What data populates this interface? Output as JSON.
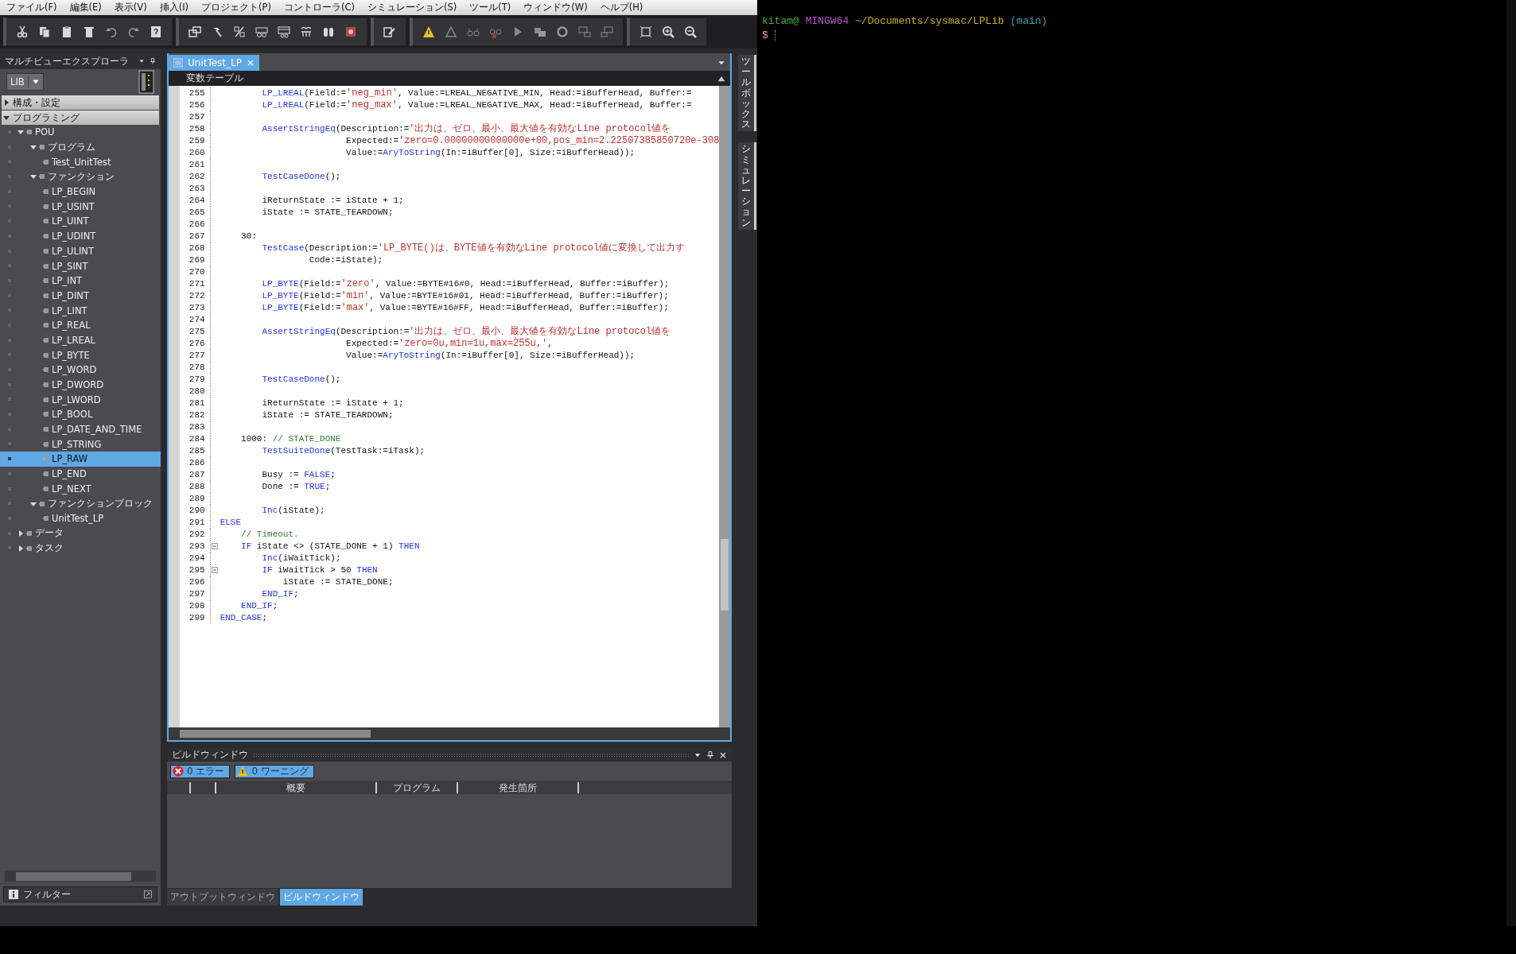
{
  "menu": [
    "ファイル(F)",
    "編集(E)",
    "表示(V)",
    "挿入(I)",
    "プロジェクト(P)",
    "コントローラ(C)",
    "シミュレーション(S)",
    "ツール(T)",
    "ウィンドウ(W)",
    "ヘルプ(H)"
  ],
  "explorer": {
    "title": "マルチビューエクスプローラ",
    "device": "LIB",
    "filter": "フィルター",
    "sections": [
      {
        "label": "構成・設定",
        "expanded": false
      },
      {
        "label": "プログラミング",
        "expanded": true,
        "children": [
          {
            "label": "POU",
            "expanded": true,
            "selected": false,
            "children": [
              {
                "label": "プログラム",
                "expanded": true,
                "selected": false,
                "children": [
                  {
                    "label": "Test_UnitTest",
                    "selected": false
                  }
                ]
              },
              {
                "label": "ファンクション",
                "expanded": true,
                "selected": false,
                "children": [
                  {
                    "label": "LP_BEGIN",
                    "selected": false
                  },
                  {
                    "label": "LP_USINT",
                    "selected": false
                  },
                  {
                    "label": "LP_UINT",
                    "selected": false
                  },
                  {
                    "label": "LP_UDINT",
                    "selected": false
                  },
                  {
                    "label": "LP_ULINT",
                    "selected": false
                  },
                  {
                    "label": "LP_SINT",
                    "selected": false
                  },
                  {
                    "label": "LP_INT",
                    "selected": false
                  },
                  {
                    "label": "LP_DINT",
                    "selected": false
                  },
                  {
                    "label": "LP_LINT",
                    "selected": false
                  },
                  {
                    "label": "LP_REAL",
                    "selected": false
                  },
                  {
                    "label": "LP_LREAL",
                    "selected": false
                  },
                  {
                    "label": "LP_BYTE",
                    "selected": false
                  },
                  {
                    "label": "LP_WORD",
                    "selected": false
                  },
                  {
                    "label": "LP_DWORD",
                    "selected": false
                  },
                  {
                    "label": "LP_LWORD",
                    "selected": false
                  },
                  {
                    "label": "LP_BOOL",
                    "selected": false
                  },
                  {
                    "label": "LP_DATE_AND_TIME",
                    "selected": false
                  },
                  {
                    "label": "LP_STRING",
                    "selected": false
                  },
                  {
                    "label": "LP_RAW",
                    "selected": true
                  },
                  {
                    "label": "LP_END",
                    "selected": false
                  },
                  {
                    "label": "LP_NEXT",
                    "selected": false
                  }
                ]
              },
              {
                "label": "ファンクションブロック",
                "expanded": true,
                "selected": false,
                "children": [
                  {
                    "label": "UnitTest_LP",
                    "selected": false
                  }
                ]
              }
            ]
          },
          {
            "label": "データ",
            "expanded": false,
            "selected": false
          },
          {
            "label": "タスク",
            "expanded": false,
            "selected": false
          }
        ]
      }
    ]
  },
  "editor": {
    "tab": {
      "label": "UnitTest_LP",
      "selected": true
    },
    "section": "変数テーブル",
    "lines": [
      {
        "number": "255",
        "fold": false,
        "segments": [
          {
            "kind": "kw",
            "text": "        LP_LREAL"
          },
          {
            "kind": "plain",
            "text": "(Field:="
          },
          {
            "kind": "string",
            "text": "'neg_min'"
          },
          {
            "kind": "plain",
            "text": ", Value:=LREAL_NEGATIVE_MIN, Head:=iBufferHead, Buffer:="
          }
        ]
      },
      {
        "number": "256",
        "fold": false,
        "segments": [
          {
            "kind": "kw",
            "text": "        LP_LREAL"
          },
          {
            "kind": "plain",
            "text": "(Field:="
          },
          {
            "kind": "string",
            "text": "'neg_max'"
          },
          {
            "kind": "plain",
            "text": ", Value:=LREAL_NEGATIVE_MAX, Head:=iBufferHead, Buffer:="
          }
        ]
      },
      {
        "number": "257",
        "fold": false
      },
      {
        "number": "258",
        "fold": false,
        "segments": [
          {
            "kind": "kw",
            "text": "        AssertStringEq"
          },
          {
            "kind": "plain",
            "text": "(Description:="
          },
          {
            "kind": "string",
            "text": "'出力は、ゼロ、最小、最大値を有効なLine protocol値を"
          }
        ]
      },
      {
        "number": "259",
        "fold": false,
        "segments": [
          {
            "kind": "plain",
            "text": "                        Expected:="
          },
          {
            "kind": "string",
            "text": "'zero=0.00000000000000e+00,pos_min=2.22507385850720e-308"
          }
        ]
      },
      {
        "number": "260",
        "fold": false,
        "segments": [
          {
            "kind": "plain",
            "text": "                        Value:="
          },
          {
            "kind": "kw",
            "text": "AryToString"
          },
          {
            "kind": "plain",
            "text": "(In:=iBuffer[0], Size:=iBufferHead));"
          }
        ]
      },
      {
        "number": "261",
        "fold": false
      },
      {
        "number": "262",
        "fold": false,
        "segments": [
          {
            "kind": "kw",
            "text": "        TestCaseDone"
          },
          {
            "kind": "plain",
            "text": "();"
          }
        ]
      },
      {
        "number": "263",
        "fold": false
      },
      {
        "number": "264",
        "fold": false,
        "segments": [
          {
            "kind": "plain",
            "text": "        iReturnState := iState + 1;"
          }
        ]
      },
      {
        "number": "265",
        "fold": false,
        "segments": [
          {
            "kind": "plain",
            "text": "        iState := STATE_TEARDOWN;"
          }
        ]
      },
      {
        "number": "266",
        "fold": false
      },
      {
        "number": "267",
        "fold": false,
        "segments": [
          {
            "kind": "plain",
            "text": "    30:"
          }
        ]
      },
      {
        "number": "268",
        "fold": false,
        "segments": [
          {
            "kind": "kw",
            "text": "        TestCase"
          },
          {
            "kind": "plain",
            "text": "(Description:="
          },
          {
            "kind": "string",
            "text": "'LP_BYTE()は、BYTE値を有効なLine protocol値に変換して出力す"
          }
        ]
      },
      {
        "number": "269",
        "fold": false,
        "segments": [
          {
            "kind": "plain",
            "text": "                 Code:=iState);"
          }
        ]
      },
      {
        "number": "270",
        "fold": false
      },
      {
        "number": "271",
        "fold": false,
        "segments": [
          {
            "kind": "kw",
            "text": "        LP_BYTE"
          },
          {
            "kind": "plain",
            "text": "(Field:="
          },
          {
            "kind": "string",
            "text": "'zero'"
          },
          {
            "kind": "plain",
            "text": ", Value:=BYTE#16#0, Head:=iBufferHead, Buffer:=iBuffer);"
          }
        ]
      },
      {
        "number": "272",
        "fold": false,
        "segments": [
          {
            "kind": "kw",
            "text": "        LP_BYTE"
          },
          {
            "kind": "plain",
            "text": "(Field:="
          },
          {
            "kind": "string",
            "text": "'min'"
          },
          {
            "kind": "plain",
            "text": ", Value:=BYTE#16#01, Head:=iBufferHead, Buffer:=iBuffer);"
          }
        ]
      },
      {
        "number": "273",
        "fold": false,
        "segments": [
          {
            "kind": "kw",
            "text": "        LP_BYTE"
          },
          {
            "kind": "plain",
            "text": "(Field:="
          },
          {
            "kind": "string",
            "text": "'max'"
          },
          {
            "kind": "plain",
            "text": ", Value:=BYTE#16#FF, Head:=iBufferHead, Buffer:=iBuffer);"
          }
        ]
      },
      {
        "number": "274",
        "fold": false
      },
      {
        "number": "275",
        "fold": false,
        "segments": [
          {
            "kind": "kw",
            "text": "        AssertStringEq"
          },
          {
            "kind": "plain",
            "text": "(Description:="
          },
          {
            "kind": "string",
            "text": "'出力は、ゼロ、最小、最大値を有効なLine protocol値を"
          }
        ]
      },
      {
        "number": "276",
        "fold": false,
        "segments": [
          {
            "kind": "plain",
            "text": "                        Expected:="
          },
          {
            "kind": "string",
            "text": "'zero=0u,min=1u,max=255u,'"
          },
          {
            "kind": "plain",
            "text": ","
          }
        ]
      },
      {
        "number": "277",
        "fold": false,
        "segments": [
          {
            "kind": "plain",
            "text": "                        Value:="
          },
          {
            "kind": "kw",
            "text": "AryToString"
          },
          {
            "kind": "plain",
            "text": "(In:=iBuffer[0], Size:=iBufferHead));"
          }
        ]
      },
      {
        "number": "278",
        "fold": false
      },
      {
        "number": "279",
        "fold": false,
        "segments": [
          {
            "kind": "kw",
            "text": "        TestCaseDone"
          },
          {
            "kind": "plain",
            "text": "();"
          }
        ]
      },
      {
        "number": "280",
        "fold": false
      },
      {
        "number": "281",
        "fold": false,
        "segments": [
          {
            "kind": "plain",
            "text": "        iReturnState := iState + 1;"
          }
        ]
      },
      {
        "number": "282",
        "fold": false,
        "segments": [
          {
            "kind": "plain",
            "text": "        iState := STATE_TEARDOWN;"
          }
        ]
      },
      {
        "number": "283",
        "fold": false
      },
      {
        "number": "284",
        "fold": false,
        "segments": [
          {
            "kind": "plain",
            "text": "    1000: "
          },
          {
            "kind": "comment",
            "text": "// STATE_DONE"
          }
        ]
      },
      {
        "number": "285",
        "fold": false,
        "segments": [
          {
            "kind": "kw",
            "text": "        TestSuiteDone"
          },
          {
            "kind": "plain",
            "text": "(TestTask:=iTask);"
          }
        ]
      },
      {
        "number": "286",
        "fold": false
      },
      {
        "number": "287",
        "fold": false,
        "segments": [
          {
            "kind": "plain",
            "text": "        Busy := "
          },
          {
            "kind": "kw",
            "text": "FALSE"
          },
          {
            "kind": "plain",
            "text": ";"
          }
        ]
      },
      {
        "number": "288",
        "fold": false,
        "segments": [
          {
            "kind": "plain",
            "text": "        Done := "
          },
          {
            "kind": "kw",
            "text": "TRUE"
          },
          {
            "kind": "plain",
            "text": ";"
          }
        ]
      },
      {
        "number": "289",
        "fold": false
      },
      {
        "number": "290",
        "fold": false,
        "segments": [
          {
            "kind": "kw",
            "text": "        Inc"
          },
          {
            "kind": "plain",
            "text": "(iState);"
          }
        ]
      },
      {
        "number": "291",
        "fold": false,
        "segments": [
          {
            "kind": "kw",
            "text": "ELSE"
          }
        ]
      },
      {
        "number": "292",
        "fold": false,
        "segments": [
          {
            "kind": "comment",
            "text": "    // Timeout."
          }
        ]
      },
      {
        "number": "293",
        "fold": true,
        "segments": [
          {
            "kind": "kw",
            "text": "    IF"
          },
          {
            "kind": "plain",
            "text": " iState <> (STATE_DONE + 1) "
          },
          {
            "kind": "kw",
            "text": "THEN"
          }
        ]
      },
      {
        "number": "294",
        "fold": false,
        "segments": [
          {
            "kind": "kw",
            "text": "        Inc"
          },
          {
            "kind": "plain",
            "text": "(iWaitTick);"
          }
        ]
      },
      {
        "number": "295",
        "fold": true,
        "segments": [
          {
            "kind": "kw",
            "text": "        IF"
          },
          {
            "kind": "plain",
            "text": " iWaitTick > 50 "
          },
          {
            "kind": "kw",
            "text": "THEN"
          }
        ]
      },
      {
        "number": "296",
        "fold": false,
        "segments": [
          {
            "kind": "plain",
            "text": "            iState := STATE_DONE;"
          }
        ]
      },
      {
        "number": "297",
        "fold": false,
        "segments": [
          {
            "kind": "kw",
            "text": "        END_IF"
          },
          {
            "kind": "plain",
            "text": ";"
          }
        ]
      },
      {
        "number": "298",
        "fold": false,
        "segments": [
          {
            "kind": "kw",
            "text": "    END_IF"
          },
          {
            "kind": "plain",
            "text": ";"
          }
        ]
      },
      {
        "number": "299",
        "fold": false,
        "segments": [
          {
            "kind": "kw",
            "text": "END_CASE"
          },
          {
            "kind": "plain",
            "text": ";"
          }
        ]
      }
    ]
  },
  "side_tabs": [
    "ツールボックス",
    "シミュレーション"
  ],
  "build": {
    "title": "ビルドウィンドウ",
    "filters": [
      {
        "kind": "error",
        "label": "0 エラー"
      },
      {
        "kind": "warning",
        "label": "0 ワーニング"
      }
    ],
    "columns": [
      "概要",
      "プログラム",
      "発生箇所"
    ]
  },
  "bottom_tabs": [
    {
      "label": "アウトプットウィンドウ",
      "selected": false
    },
    {
      "label": "ビルドウィンドウ",
      "selected": true
    }
  ],
  "terminal": {
    "prompt_line": [
      {
        "kind": "user",
        "text": "kitam@"
      },
      {
        "kind": "host",
        "text": "MINGW64"
      },
      {
        "kind": "path",
        "text": "~/Documents/sysmac/LPLib"
      },
      {
        "kind": "branch",
        "text": "(main)"
      }
    ],
    "prompt": "$"
  }
}
